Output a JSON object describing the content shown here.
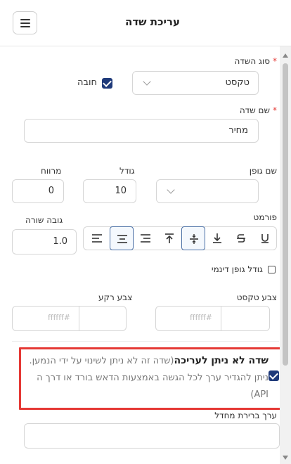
{
  "header": {
    "title": "עריכת שדה",
    "menu_icon": "hamburger-icon"
  },
  "field_type": {
    "label": "סוג השדה",
    "value": "טקסט",
    "required_mark": "*"
  },
  "required_checkbox": {
    "label": "חובה",
    "checked": true
  },
  "field_name": {
    "label": "שם שדה",
    "value": "מחיר",
    "required_mark": "*"
  },
  "font_name": {
    "label": "שם גופן",
    "value": ""
  },
  "font_size": {
    "label": "גודל",
    "value": "10"
  },
  "spacing": {
    "label": "מרווח",
    "value": "0"
  },
  "format": {
    "label": "פורמט",
    "buttons": [
      "underline-icon",
      "strikethrough-icon",
      "align-bottom-icon",
      "align-middle-icon",
      "align-top-icon",
      "align-right-icon",
      "align-center-icon",
      "align-left-icon"
    ],
    "selected": [
      "align-middle-icon",
      "align-center-icon"
    ]
  },
  "line_height": {
    "label": "גובה שורה",
    "value": "1.0"
  },
  "dynamic_font": {
    "label": "גודל גופן דינמי",
    "checked": false
  },
  "text_color": {
    "label": "צבע טקסט",
    "placeholder": "ffffff#"
  },
  "bg_color": {
    "label": "צבע רקע",
    "placeholder": "ffffff#"
  },
  "readonly": {
    "checked": true,
    "title": "שדה לא ניתן לעריכה",
    "description": "(שדה זה לא ניתן לשינוי על ידי הנמען. ניתן להגדיר ערך לכל הגשה באמצעות הדאש בורד או דרך ה API)"
  },
  "default_value": {
    "label": "ערך ברירת מחדל",
    "value": ""
  },
  "colors": {
    "accent": "#1f3a7a",
    "highlight": "#e53935",
    "required": "#e53935"
  }
}
